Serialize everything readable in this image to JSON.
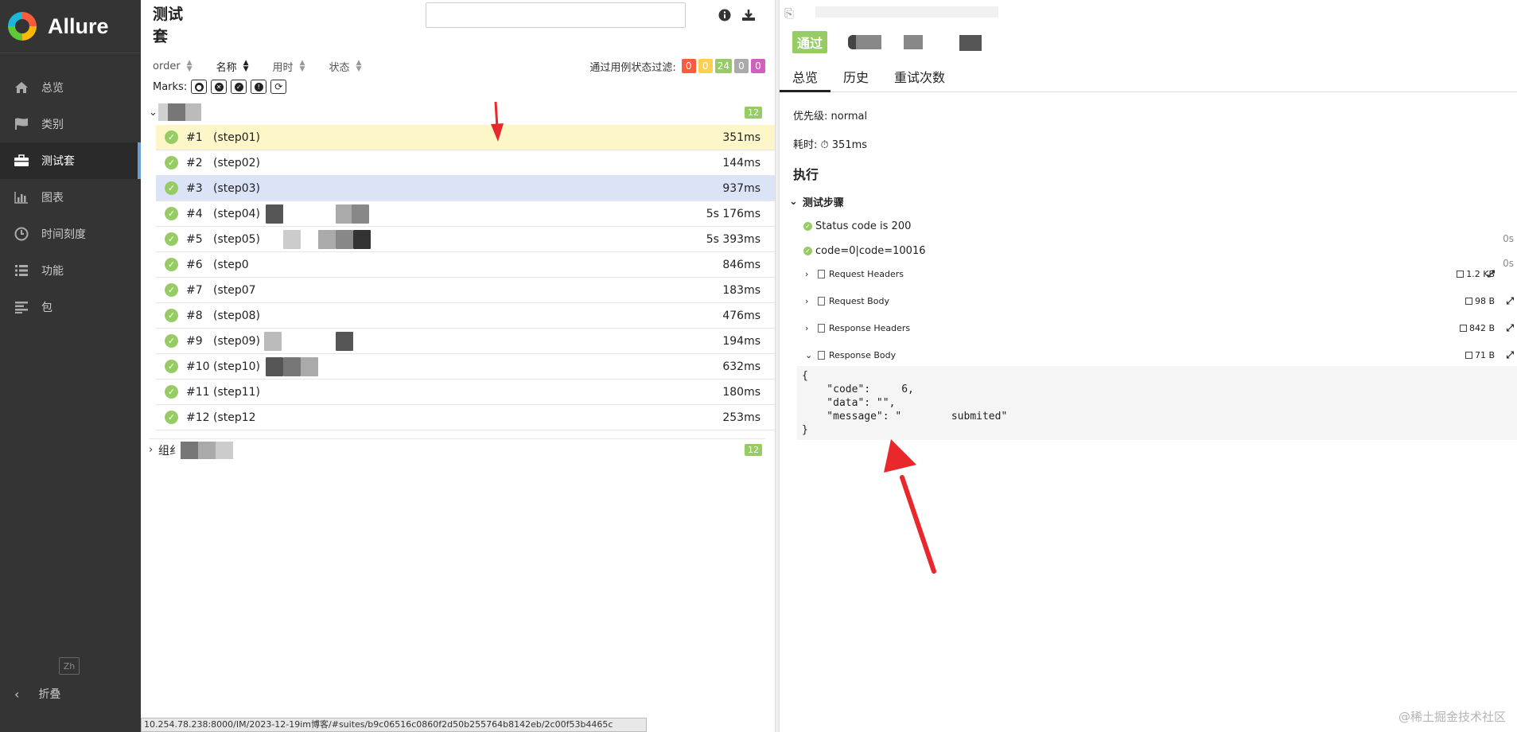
{
  "sidebar": {
    "brand": "Allure",
    "items": [
      {
        "label": "总览",
        "icon": "home-icon"
      },
      {
        "label": "类别",
        "icon": "flag-icon"
      },
      {
        "label": "测试套",
        "icon": "briefcase-icon"
      },
      {
        "label": "图表",
        "icon": "bar-chart-icon"
      },
      {
        "label": "时间刻度",
        "icon": "clock-icon"
      },
      {
        "label": "功能",
        "icon": "list-icon"
      },
      {
        "label": "包",
        "icon": "align-left-icon"
      }
    ],
    "lang": "Zh",
    "collapse": "折叠"
  },
  "left": {
    "title": "测试套",
    "search": {
      "value": "",
      "placeholder": ""
    },
    "sort": [
      {
        "label": "order"
      },
      {
        "label": "名称"
      },
      {
        "label": "用时"
      },
      {
        "label": "状态"
      }
    ],
    "filter_label": "通过用例状态过滤:",
    "filter_badges": [
      {
        "value": "0",
        "color": "#fd5a3e"
      },
      {
        "value": "0",
        "color": "#ffd050"
      },
      {
        "value": "24",
        "color": "#97cc64"
      },
      {
        "value": "0",
        "color": "#aaaaaa"
      },
      {
        "value": "0",
        "color": "#d35ebe"
      }
    ],
    "marks_label": "Marks:",
    "group1": {
      "count": "12"
    },
    "rows": [
      {
        "num": "#1",
        "name": "(step01)",
        "dur": "351ms"
      },
      {
        "num": "#2",
        "name": "(step02)",
        "dur": "144ms"
      },
      {
        "num": "#3",
        "name": "(step03)",
        "dur": "937ms"
      },
      {
        "num": "#4",
        "name": "(step04)",
        "dur": "5s 176ms"
      },
      {
        "num": "#5",
        "name": "(step05)",
        "dur": "5s 393ms"
      },
      {
        "num": "#6",
        "name": "(step0",
        "dur": "846ms"
      },
      {
        "num": "#7",
        "name": "(step07",
        "dur": "183ms"
      },
      {
        "num": "#8",
        "name": "(step08)",
        "dur": "476ms"
      },
      {
        "num": "#9",
        "name": "(step09)",
        "dur": "194ms"
      },
      {
        "num": "#10",
        "name": "(step10)",
        "dur": "632ms"
      },
      {
        "num": "#11",
        "name": "(step11)",
        "dur": "180ms"
      },
      {
        "num": "#12",
        "name": "(step12",
        "dur": "253ms"
      }
    ],
    "group2": {
      "label": "组纟",
      "count": "12"
    },
    "statusbar": "10.254.78.238:8000/IM/2023-12-19im博客/#suites/b9c06516c0860f2d50b255764b8142eb/2c00f53b4465c"
  },
  "right": {
    "status": "通过",
    "tabs": [
      "总览",
      "历史",
      "重试次数"
    ],
    "priority": "优先级: normal",
    "duration": "耗时: ⏱ 351ms",
    "section": "执行",
    "steps_title": "测试步骤",
    "checks": [
      {
        "text": "Status code is 200",
        "time": "0s"
      },
      {
        "text": "code=0|code=10016",
        "time": "0s"
      }
    ],
    "attachments": [
      {
        "name": "Request Headers",
        "size": "1.2 KB",
        "open": false
      },
      {
        "name": "Request Body",
        "size": "98 B",
        "open": false
      },
      {
        "name": "Response Headers",
        "size": "842 B",
        "open": false
      },
      {
        "name": "Response Body",
        "size": "71 B",
        "open": true
      }
    ],
    "code": "{\n    \"code\":     6,\n    \"data\": \"\",\n    \"message\": \"        submited\"\n}"
  },
  "watermark": "@稀土掘金技术社区",
  "colors": {
    "passed": "#97cc64",
    "arrow": "#e8282b",
    "sidebar": "#343434"
  }
}
